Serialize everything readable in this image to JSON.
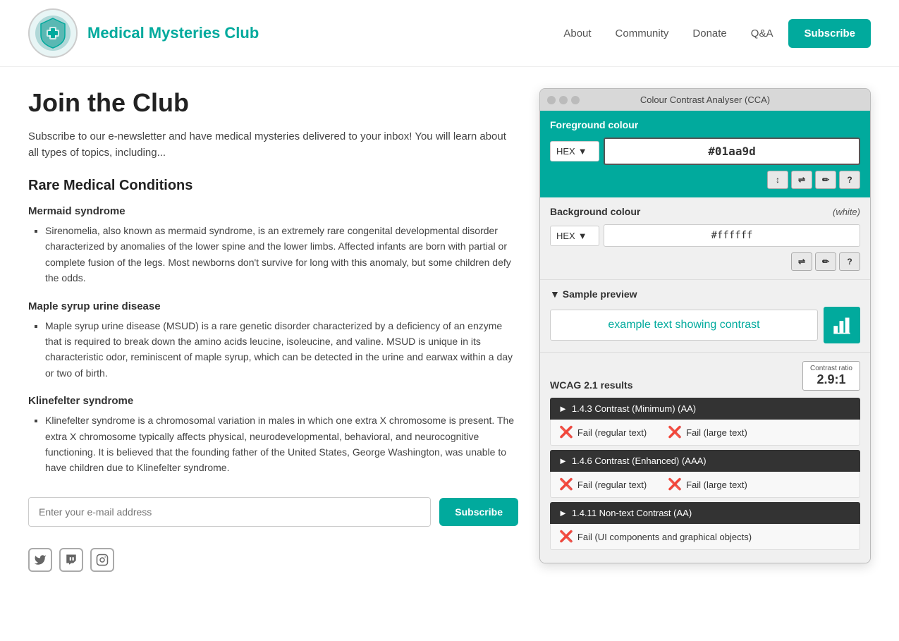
{
  "header": {
    "logo_alt": "Medical Mysteries Club Logo",
    "site_title": "Medical Mysteries Club",
    "nav": {
      "about": "About",
      "community": "Community",
      "donate": "Donate",
      "qna": "Q&A",
      "subscribe": "Subscribe"
    }
  },
  "content": {
    "page_heading": "Join the Club",
    "intro": "Subscribe to our e-newsletter and have medical mysteries delivered to your inbox! You will learn about all types of topics, including...",
    "rare_conditions_heading": "Rare Medical Conditions",
    "conditions": [
      {
        "name": "Mermaid syndrome",
        "description": "Sirenomelia, also known as mermaid syndrome, is an extremely rare congenital developmental disorder characterized by anomalies of the lower spine and the lower limbs. Affected infants are born with partial or complete fusion of the legs. Most newborns don't survive for long with this anomaly, but some children defy the odds."
      },
      {
        "name": "Maple syrup urine disease",
        "description": "Maple syrup urine disease (MSUD) is a rare genetic disorder characterized by a deficiency of an enzyme that is required to break down the amino acids leucine, isoleucine, and valine. MSUD is unique in its characteristic odor, reminiscent of maple syrup, which can be detected in the urine and earwax within a day or two of birth."
      },
      {
        "name": "Klinefelter syndrome",
        "description": "Klinefelter syndrome is a chromosomal variation in males in which one extra X chromosome is present. The extra X chromosome typically affects physical, neurodevelopmental, behavioral, and neurocognitive functioning. It is believed that the founding father of the United States, George Washington, was unable to have children due to Klinefelter syndrome."
      }
    ],
    "email_placeholder": "Enter your e-mail address",
    "subscribe_inline": "Subscribe",
    "social": {
      "twitter": "Twitter",
      "twitch": "Twitch",
      "instagram": "Instagram"
    }
  },
  "cca": {
    "title": "Colour Contrast Analyser (CCA)",
    "foreground_label": "Foreground colour",
    "fg_format": "HEX",
    "fg_value": "#01aa9d",
    "fg_tools": [
      "↕",
      "⇌",
      "✏",
      "?"
    ],
    "background_label": "Background colour",
    "bg_note": "(white)",
    "bg_format": "HEX",
    "bg_value": "#ffffff",
    "bg_tools": [
      "⇌",
      "✏",
      "?"
    ],
    "preview_label": "▼ Sample preview",
    "sample_text": "example text showing contrast",
    "wcag_label": "WCAG 2.1 results",
    "contrast_ratio_label": "Contrast ratio",
    "contrast_ratio_val": "2.9:1",
    "criteria": [
      {
        "id": "1.4.3",
        "name": "1.4.3 Contrast (Minimum) (AA)",
        "results": [
          {
            "status": "Fail",
            "label": "Fail (regular text)"
          },
          {
            "status": "Fail",
            "label": "Fail (large text)"
          }
        ]
      },
      {
        "id": "1.4.6",
        "name": "1.4.6 Contrast (Enhanced) (AAA)",
        "results": [
          {
            "status": "Fail",
            "label": "Fail (regular text)"
          },
          {
            "status": "Fail",
            "label": "Fail (large text)"
          }
        ]
      },
      {
        "id": "1.4.11",
        "name": "1.4.11 Non-text Contrast (AA)",
        "results": [
          {
            "status": "Fail",
            "label": "Fail (UI components and graphical objects)"
          }
        ]
      }
    ]
  }
}
